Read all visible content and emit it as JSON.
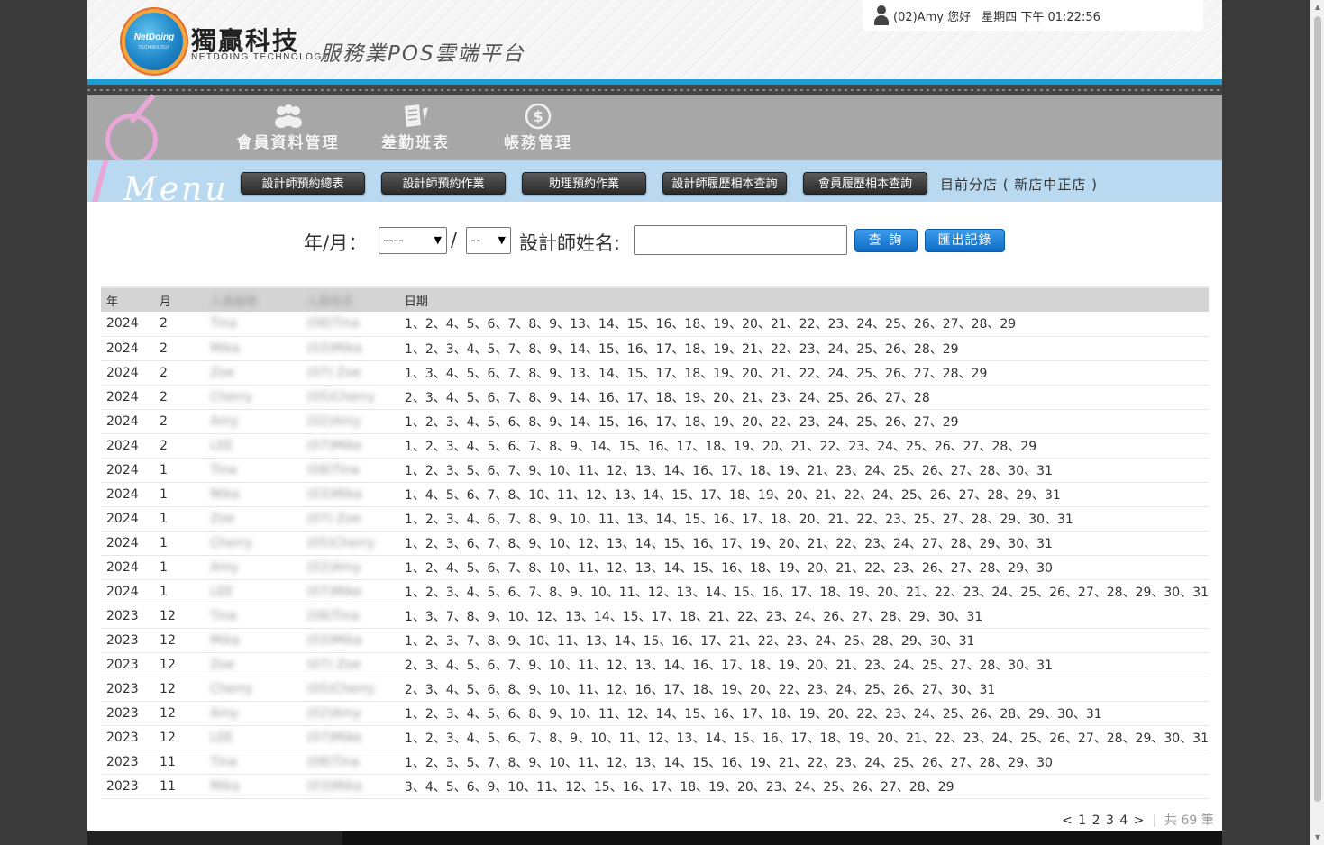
{
  "header": {
    "logo_text": "NetDoing",
    "logo_sub": "TECHNOLOGY",
    "brand_cn": "獨贏科技",
    "brand_en": "NETDOING TECHNOLOGY",
    "platform": "服務業POS雲端平台",
    "user_greeting": "(02)Amy 您好",
    "datetime": "星期四 下午 01:22:56"
  },
  "nav": {
    "items": [
      {
        "label": "會員資料管理",
        "icon": "members-icon"
      },
      {
        "label": "差勤班表",
        "icon": "document-icon"
      },
      {
        "label": "帳務管理",
        "icon": "dollar-icon"
      }
    ]
  },
  "submenu": {
    "menu_word": "Menu",
    "buttons": [
      "設計師預約總表",
      "設計師預約作業",
      "助理預約作業",
      "設計師履歷相本查詢",
      "會員履歷相本查詢"
    ],
    "branch": "目前分店 ( 新店中正店 )"
  },
  "query": {
    "year_month_label": "年/月：",
    "year_value": "----",
    "separator": "/",
    "month_value": "--",
    "designer_label": "設計師姓名:",
    "search_button": "查 詢",
    "export_button": "匯出記錄"
  },
  "table": {
    "headers": [
      "年",
      "月",
      "人員編號",
      "人員姓名",
      "日期"
    ],
    "rows": [
      {
        "year": "2024",
        "month": "2",
        "id": "Tina",
        "name": "(08)Tina",
        "dates": "1、2、4、5、6、7、8、9、13、14、15、16、18、19、20、21、22、23、24、25、26、27、28、29"
      },
      {
        "year": "2024",
        "month": "2",
        "id": "Mika",
        "name": "(03)Mika",
        "dates": "1、2、3、4、5、7、8、9、14、15、16、17、18、19、21、22、23、24、25、26、28、29"
      },
      {
        "year": "2024",
        "month": "2",
        "id": "Zoe",
        "name": "(07) Zoe",
        "dates": "1、3、4、5、6、7、8、9、13、14、15、17、18、19、20、21、22、24、25、26、27、28、29"
      },
      {
        "year": "2024",
        "month": "2",
        "id": "Cherry",
        "name": "(05)Cherry",
        "dates": "2、3、4、5、6、7、8、9、14、16、17、18、19、20、21、23、24、25、26、27、28"
      },
      {
        "year": "2024",
        "month": "2",
        "id": "Amy",
        "name": "(02)Amy",
        "dates": "1、2、3、4、5、6、8、9、14、15、16、17、18、19、20、22、23、24、25、26、27、29"
      },
      {
        "year": "2024",
        "month": "2",
        "id": "LEE",
        "name": "(07)Mike",
        "dates": "1、2、3、4、5、6、7、8、9、14、15、16、17、18、19、20、21、22、23、24、25、26、27、28、29"
      },
      {
        "year": "2024",
        "month": "1",
        "id": "Tina",
        "name": "(08)Tina",
        "dates": "1、2、3、5、6、7、9、10、11、12、13、14、16、17、18、19、21、23、24、25、26、27、28、30、31"
      },
      {
        "year": "2024",
        "month": "1",
        "id": "Mika",
        "name": "(03)Mika",
        "dates": "1、4、5、6、7、8、10、11、12、13、14、15、17、18、19、20、21、22、24、25、26、27、28、29、31"
      },
      {
        "year": "2024",
        "month": "1",
        "id": "Zoe",
        "name": "(07) Zoe",
        "dates": "1、2、3、4、6、7、8、9、10、11、13、14、15、16、17、18、20、21、22、23、25、27、28、29、30、31"
      },
      {
        "year": "2024",
        "month": "1",
        "id": "Cherry",
        "name": "(05)Cherry",
        "dates": "1、2、3、6、7、8、9、10、12、13、14、15、16、17、19、20、21、22、23、24、27、28、29、30、31"
      },
      {
        "year": "2024",
        "month": "1",
        "id": "Amy",
        "name": "(02)Amy",
        "dates": "1、2、4、5、6、7、8、10、11、12、13、14、15、16、18、19、20、21、22、23、26、27、28、29、30"
      },
      {
        "year": "2024",
        "month": "1",
        "id": "LEE",
        "name": "(07)Mike",
        "dates": "1、2、3、4、5、6、7、8、9、10、11、12、13、14、15、16、17、18、19、20、21、22、23、24、25、26、27、28、29、30、31"
      },
      {
        "year": "2023",
        "month": "12",
        "id": "Tina",
        "name": "(08)Tina",
        "dates": "1、3、7、8、9、10、12、13、14、15、17、18、21、22、23、24、26、27、28、29、30、31"
      },
      {
        "year": "2023",
        "month": "12",
        "id": "Mika",
        "name": "(03)Mika",
        "dates": "1、2、3、7、8、9、10、11、13、14、15、16、17、21、22、23、24、25、28、29、30、31"
      },
      {
        "year": "2023",
        "month": "12",
        "id": "Zoe",
        "name": "(07) Zoe",
        "dates": "2、3、4、5、6、7、9、10、11、12、13、14、16、17、18、19、20、21、23、24、25、27、28、30、31"
      },
      {
        "year": "2023",
        "month": "12",
        "id": "Cherry",
        "name": "(05)Cherry",
        "dates": "2、3、4、5、6、8、9、10、11、12、16、17、18、19、20、22、23、24、25、26、27、30、31"
      },
      {
        "year": "2023",
        "month": "12",
        "id": "Amy",
        "name": "(02)Amy",
        "dates": "1、2、3、4、5、6、8、9、10、11、12、14、15、16、17、18、19、20、22、23、24、25、26、28、29、30、31"
      },
      {
        "year": "2023",
        "month": "12",
        "id": "LEE",
        "name": "(07)Mike",
        "dates": "1、2、3、4、5、6、7、8、9、10、11、12、13、14、15、16、17、18、19、20、21、22、23、24、25、26、27、28、29、30、31"
      },
      {
        "year": "2023",
        "month": "11",
        "id": "Tina",
        "name": "(08)Tina",
        "dates": "1、2、3、5、7、8、9、10、11、12、13、14、15、16、19、21、22、23、24、25、26、27、28、29、30"
      },
      {
        "year": "2023",
        "month": "11",
        "id": "Mika",
        "name": "(03)Mika",
        "dates": "3、4、5、6、9、10、11、12、15、16、17、18、19、20、23、24、25、26、27、28、29"
      }
    ]
  },
  "pager": {
    "prev": "<",
    "pages": [
      "1",
      "2",
      "3",
      "4"
    ],
    "next": ">",
    "divider": "|",
    "total": "共 69 筆"
  },
  "colors": {
    "accent_blue": "#1a9fd8",
    "nav_gray": "#a7a7a7",
    "submenu_blue": "#b9d9f0",
    "button_blue": "#0f6cc5"
  }
}
